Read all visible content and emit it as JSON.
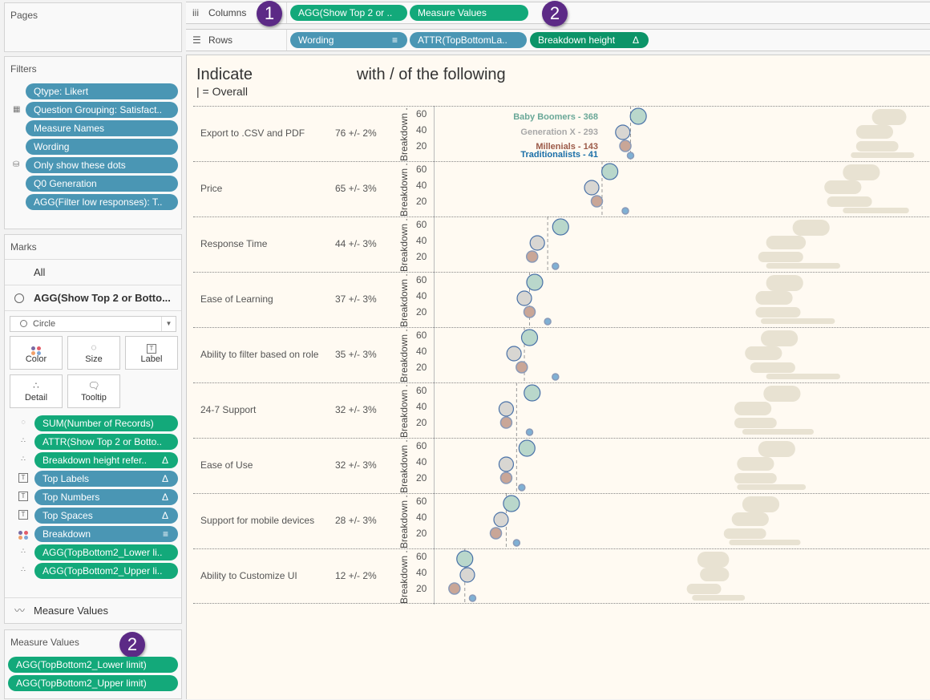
{
  "left_panel": {
    "pages": {
      "title": "Pages"
    },
    "filters": {
      "title": "Filters",
      "items": [
        {
          "label": "Qtype: Likert",
          "icon": ""
        },
        {
          "label": "Question Grouping: Satisfact..",
          "icon": "context-icon"
        },
        {
          "label": "Measure Names",
          "icon": ""
        },
        {
          "label": "Wording",
          "icon": ""
        },
        {
          "label": "Only show these dots",
          "icon": "database-icon"
        },
        {
          "label": "Q0 Generation",
          "icon": ""
        },
        {
          "label": "AGG(Filter low responses): T..",
          "icon": ""
        }
      ]
    },
    "marks": {
      "title": "Marks",
      "all_label": "All",
      "active_card": "AGG(Show Top 2 or Botto...",
      "mark_type": "Circle",
      "buttons": [
        {
          "label": "Color",
          "icon": "color-icon"
        },
        {
          "label": "Size",
          "icon": "size-icon"
        },
        {
          "label": "Label",
          "icon": "label-icon"
        },
        {
          "label": "Detail",
          "icon": "detail-icon"
        },
        {
          "label": "Tooltip",
          "icon": "tooltip-icon"
        }
      ],
      "fields": [
        {
          "label": "SUM(Number of Records)",
          "icon": "size-icon",
          "color": "green",
          "delta": false
        },
        {
          "label": "ATTR(Show Top 2 or Botto..",
          "icon": "detail-icon",
          "color": "green",
          "delta": false
        },
        {
          "label": "Breakdown height refer..",
          "icon": "detail-icon",
          "color": "green",
          "delta": true
        },
        {
          "label": "Top Labels",
          "icon": "label-icon",
          "color": "blue",
          "delta": true
        },
        {
          "label": "Top Numbers",
          "icon": "label-icon",
          "color": "blue",
          "delta": true
        },
        {
          "label": "Top Spaces",
          "icon": "label-icon",
          "color": "blue",
          "delta": true
        },
        {
          "label": "Breakdown",
          "icon": "color-icon",
          "color": "blue",
          "delta": false,
          "sort": true
        },
        {
          "label": "AGG(TopBottom2_Lower li..",
          "icon": "detail-icon",
          "color": "green",
          "delta": false
        },
        {
          "label": "AGG(TopBottom2_Upper li..",
          "icon": "detail-icon",
          "color": "green",
          "delta": false
        }
      ],
      "measure_values_card": "Measure Values"
    },
    "measure_values": {
      "title": "Measure Values",
      "badge": "2",
      "items": [
        "AGG(TopBottom2_Lower limit)",
        "AGG(TopBottom2_Upper limit)"
      ]
    }
  },
  "shelves": {
    "columns": {
      "label": "Columns",
      "pills": [
        "AGG(Show Top 2 or ..",
        "Measure Values"
      ],
      "badge_left": "1",
      "badge_right": "2"
    },
    "rows": {
      "label": "Rows",
      "pills": [
        "Wording",
        "ATTR(TopBottomLa..",
        "Breakdown height"
      ],
      "delta": "Δ"
    }
  },
  "viz": {
    "title_left": "Indicate",
    "title_right": "with / of the following",
    "subtitle": "| = Overall",
    "axis_label": "Breakdown .",
    "ticks": [
      "60",
      "40",
      "20"
    ]
  },
  "colors": {
    "baby_boomers": "#b9d7cb",
    "generation_x": "#d8d6d2",
    "millenials": "#c9a697",
    "traditionalists": "#7fb0d4",
    "ci_bar": "#e8e2d2",
    "label_bb": "#6aa898",
    "label_gx": "#a8a8a8",
    "label_mil": "#9c5a48",
    "label_trad": "#1a6fa8"
  },
  "chart_data": {
    "type": "scatter",
    "title": "Indicate with / of the following",
    "subtitle": "| = Overall",
    "xlabel": "",
    "ylabel": "Breakdown",
    "y_ticks": [
      60,
      40,
      20
    ],
    "legend_labels": [
      {
        "name": "Baby Boomers",
        "count": 368
      },
      {
        "name": "Generation X",
        "count": 293
      },
      {
        "name": "Millenials",
        "count": 143
      },
      {
        "name": "Traditionalists",
        "count": 41
      }
    ],
    "series_names": [
      "Baby Boomers",
      "Generation X",
      "Millenials",
      "Traditionalists"
    ],
    "rows": [
      {
        "wording": "Export to .CSV and PDF",
        "overall_label": "76 +/- 2%",
        "overall": 76,
        "values": [
          79,
          73,
          74,
          76
        ],
        "ci": [
          [
            72,
            85
          ],
          [
            66,
            80
          ],
          [
            66,
            82
          ],
          [
            64,
            88
          ]
        ]
      },
      {
        "wording": "Price",
        "overall_label": "65 +/- 3%",
        "overall": 65,
        "values": [
          68,
          61,
          63,
          74
        ],
        "ci": [
          [
            61,
            75
          ],
          [
            54,
            68
          ],
          [
            55,
            72
          ],
          [
            61,
            86
          ]
        ]
      },
      {
        "wording": "Response Time",
        "overall_label": "44 +/- 3%",
        "overall": 44,
        "values": [
          49,
          40,
          38,
          47
        ],
        "ci": [
          [
            42,
            56
          ],
          [
            32,
            47
          ],
          [
            29,
            46
          ],
          [
            32,
            60
          ]
        ]
      },
      {
        "wording": "Ease of Learning",
        "overall_label": "37 +/- 3%",
        "overall": 37,
        "values": [
          39,
          35,
          37,
          44
        ],
        "ci": [
          [
            32,
            46
          ],
          [
            28,
            42
          ],
          [
            28,
            45
          ],
          [
            30,
            58
          ]
        ]
      },
      {
        "wording": "Ability to filter based on role",
        "overall_label": "35 +/- 3%",
        "overall": 35,
        "values": [
          37,
          31,
          34,
          47
        ],
        "ci": [
          [
            30,
            44
          ],
          [
            24,
            38
          ],
          [
            26,
            43
          ],
          [
            32,
            60
          ]
        ]
      },
      {
        "wording": "24-7 Support",
        "overall_label": "32 +/- 3%",
        "overall": 32,
        "values": [
          38,
          28,
          28,
          37
        ],
        "ci": [
          [
            31,
            45
          ],
          [
            20,
            34
          ],
          [
            20,
            36
          ],
          [
            23,
            50
          ]
        ]
      },
      {
        "wording": "Ease of Use",
        "overall_label": "32 +/- 3%",
        "overall": 32,
        "values": [
          36,
          28,
          28,
          34
        ],
        "ci": [
          [
            29,
            43
          ],
          [
            21,
            35
          ],
          [
            20,
            36
          ],
          [
            21,
            47
          ]
        ]
      },
      {
        "wording": "Support for mobile devices",
        "overall_label": "28 +/- 3%",
        "overall": 28,
        "values": [
          30,
          26,
          24,
          32
        ],
        "ci": [
          [
            23,
            37
          ],
          [
            19,
            33
          ],
          [
            16,
            32
          ],
          [
            18,
            45
          ]
        ]
      },
      {
        "wording": "Ability to Customize UI",
        "overall_label": "12 +/- 2%",
        "overall": 12,
        "values": [
          12,
          13,
          8,
          15
        ],
        "ci": [
          [
            6,
            18
          ],
          [
            7,
            18
          ],
          [
            2,
            15
          ],
          [
            4,
            24
          ]
        ]
      }
    ]
  }
}
